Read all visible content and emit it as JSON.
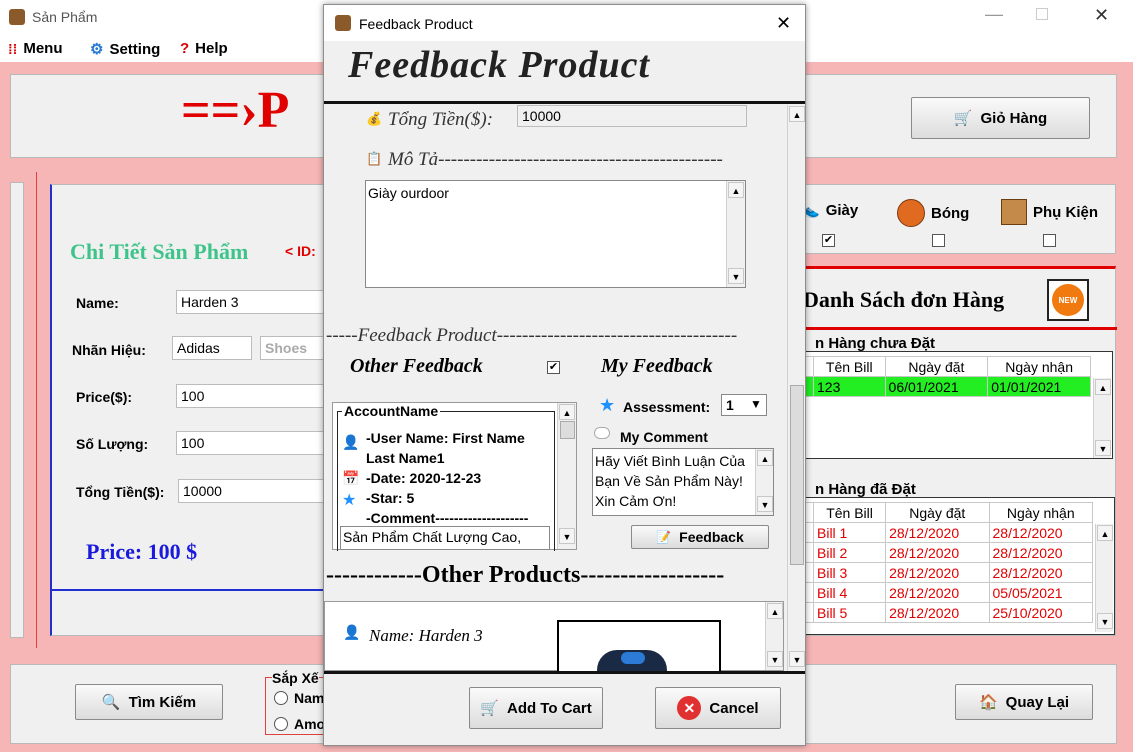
{
  "window": {
    "title": "Sản Phẩm"
  },
  "menu": {
    "items": [
      {
        "label": "Menu",
        "icon": "grid-icon"
      },
      {
        "label": "Setting",
        "icon": "gear-icon"
      },
      {
        "label": "Help",
        "icon": "question-icon"
      }
    ]
  },
  "header": {
    "cart_label": "Giỏ Hàng"
  },
  "detail": {
    "title": "Chi Tiết Sản Phẩm",
    "id_label": "< ID:",
    "name_label": "Name:",
    "name_value": "Harden 3",
    "brand_label": "Nhãn Hiệu:",
    "brand_value": "Adidas",
    "type_value": "Shoes",
    "price_label": "Price($):",
    "price_value": "100",
    "qty_label": "Số Lượng:",
    "qty_value": "100",
    "total_label": "Tổng Tiền($):",
    "total_value": "10000",
    "price_big": "Price: 100 $"
  },
  "categories": [
    {
      "label": "Giày",
      "checked": true
    },
    {
      "label": "Bóng",
      "checked": false
    },
    {
      "label": "Phụ Kiện",
      "checked": false
    }
  ],
  "orders": {
    "title": "Danh Sách đơn Hàng",
    "new_badge": "NEW",
    "pending_title": "n Hàng chưa Đặt",
    "done_title": "n Hàng đã Đặt",
    "cols": [
      "Tên Bill",
      "Ngày đặt",
      "Ngày nhận"
    ],
    "pending_rows": [
      [
        "123",
        "06/01/2021",
        "01/01/2021"
      ]
    ],
    "done_rows": [
      [
        "Bill 1",
        "28/12/2020",
        "28/12/2020"
      ],
      [
        "Bill 2",
        "28/12/2020",
        "28/12/2020"
      ],
      [
        "Bill 3",
        "28/12/2020",
        "28/12/2020"
      ],
      [
        "Bill 4",
        "28/12/2020",
        "05/05/2021"
      ],
      [
        "Bill 5",
        "28/12/2020",
        "25/10/2020"
      ]
    ]
  },
  "footer": {
    "search_label": "Tìm Kiếm",
    "sort_title": "Sắp Xế",
    "sort_opt1": "Nam",
    "sort_opt2": "Amo",
    "back_label": "Quay Lại"
  },
  "dialog": {
    "title": "Feedback Product",
    "heading": "Feedback Product",
    "total_label": "Tổng Tiền($):",
    "total_value": "10000",
    "desc_label": "Mô Tả---------------------------------------------",
    "desc_value": "Giày ourdoor",
    "feedback_section": "-----Feedback Product--------------------------------------",
    "other_feedback": "Other Feedback",
    "other_checked": "✔",
    "my_feedback": "My Feedback",
    "account_title": "AccountName",
    "user_line1": "-User Name: First Name",
    "user_line2": "Last Name1",
    "date": "-Date: 2020-12-23",
    "star": "-Star: 5",
    "comment_label": "-Comment--------------------",
    "comment_value": "Sản Phẩm Chất Lượng Cao,",
    "assessment_label": "Assessment:",
    "assessment_value": "1",
    "my_comment_label": "My Comment",
    "my_comment_value": "Hãy Viết Bình Luận Của Bạn Về Sản Phẩm Này! Xin Cảm Ơn!",
    "feedback_btn": "Feedback",
    "other_products": "------------Other Products------------------",
    "product_name": "Name: Harden 3",
    "add_cart": "Add To Cart",
    "cancel": "Cancel"
  }
}
